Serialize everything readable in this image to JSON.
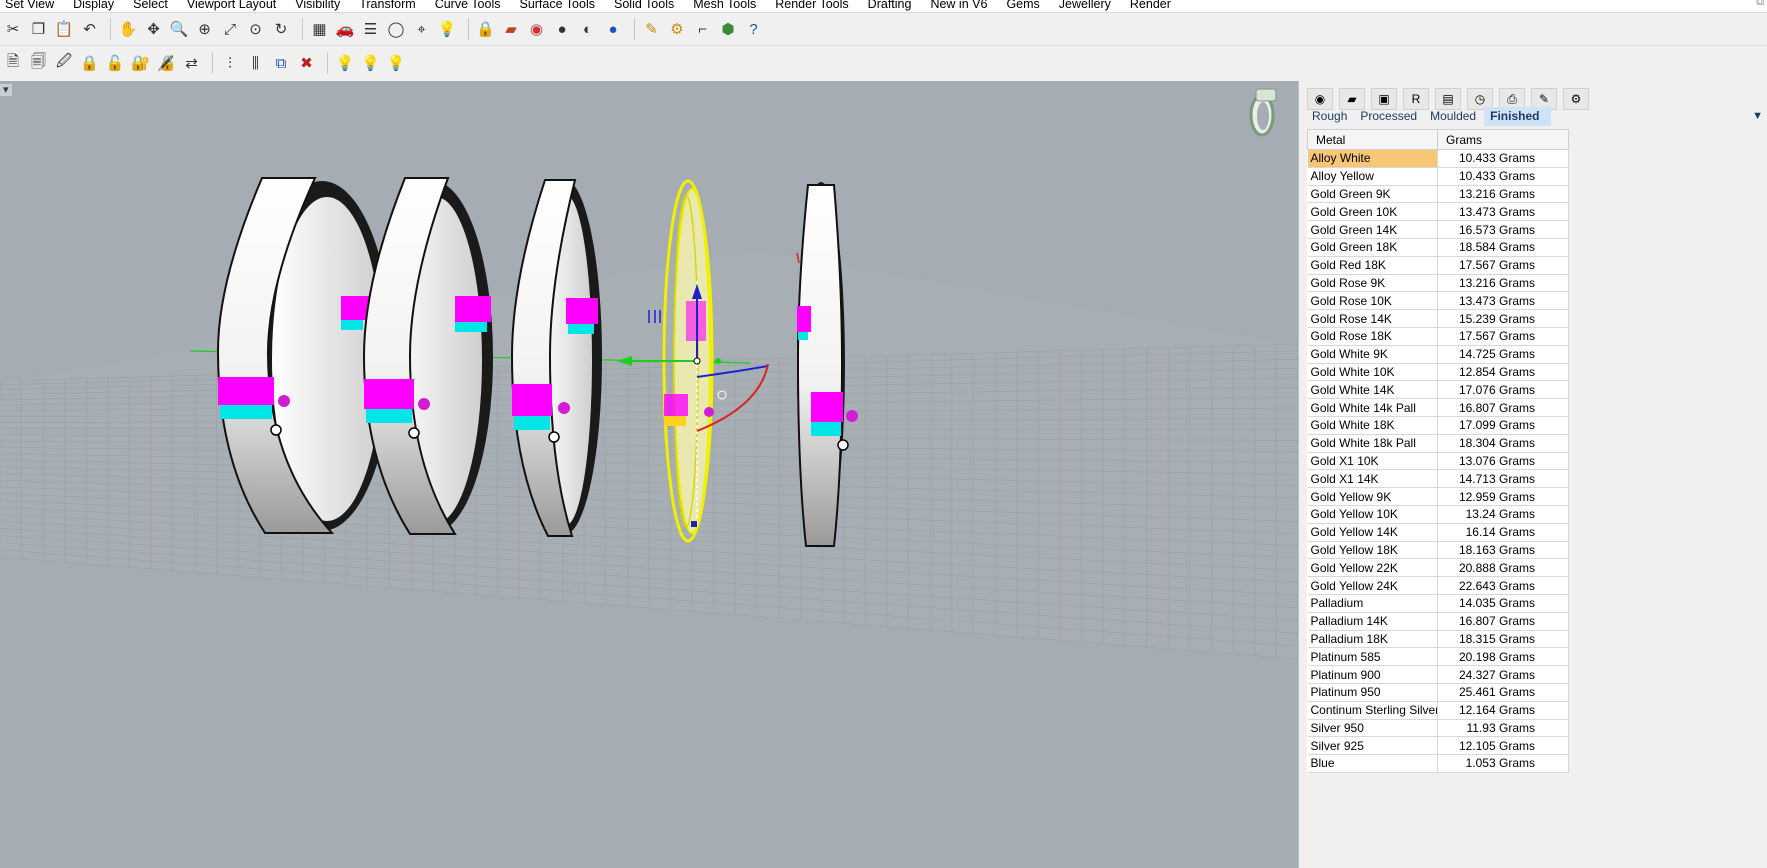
{
  "menu": [
    "Set View",
    "Display",
    "Select",
    "Viewport Layout",
    "Visibility",
    "Transform",
    "Curve Tools",
    "Surface Tools",
    "Solid Tools",
    "Mesh Tools",
    "Render Tools",
    "Drafting",
    "New in V6",
    "Gems",
    "Jewellery",
    "Render"
  ],
  "toolbar1_icons": [
    "cut-icon",
    "copy-icon",
    "paste-icon",
    "undo-icon",
    "pan-hand-icon",
    "rotate-icon",
    "zoom-icon",
    "zoom-window-icon",
    "zoom-extents-icon",
    "zoom-selected-icon",
    "rotate-view-icon",
    "grid-layout-icon",
    "car-icon",
    "layers-icon",
    "circle-icon",
    "snap-icon",
    "light-bulb-icon",
    "lock-icon",
    "material-icon",
    "color-wheel-icon",
    "shaded-sphere-icon",
    "rendered-sphere-icon",
    "blue-sphere-icon",
    "pen-icon",
    "gear-icon",
    "dimension-icon",
    "plugin-icon",
    "help-icon"
  ],
  "toolbar2_icons": [
    "document-icon",
    "document-properties-icon",
    "document-edit-icon",
    "lock-icon",
    "unlock-icon",
    "lock-selected-icon",
    "unlock-selected-icon",
    "swap-icon",
    "align-icon",
    "distribute-icon",
    "select-filter-icon",
    "delete-filter-icon",
    "bulb-on-icon",
    "bulb-off-icon",
    "bulb-toggle-icon"
  ],
  "panel": {
    "icons": [
      "color-icon",
      "material-icon",
      "display-icon",
      "rg-icon",
      "folder-icon",
      "time-icon",
      "print-icon",
      "edit-icon",
      "settings-icon"
    ],
    "tabs": [
      "Rough",
      "Processed",
      "Moulded",
      "Finished"
    ],
    "active_tab": "Finished",
    "columns": [
      "Metal",
      "Grams"
    ],
    "rows": [
      {
        "metal": "Alloy White",
        "grams": "10.433 Grams"
      },
      {
        "metal": "Alloy Yellow",
        "grams": "10.433 Grams"
      },
      {
        "metal": "Gold Green 9K",
        "grams": "13.216 Grams"
      },
      {
        "metal": "Gold Green 10K",
        "grams": "13.473 Grams"
      },
      {
        "metal": "Gold Green 14K",
        "grams": "16.573 Grams"
      },
      {
        "metal": "Gold Green 18K",
        "grams": "18.584 Grams"
      },
      {
        "metal": "Gold Red 18K",
        "grams": "17.567 Grams"
      },
      {
        "metal": "Gold Rose 9K",
        "grams": "13.216 Grams"
      },
      {
        "metal": "Gold Rose 10K",
        "grams": "13.473 Grams"
      },
      {
        "metal": "Gold Rose 14K",
        "grams": "15.239 Grams"
      },
      {
        "metal": "Gold Rose 18K",
        "grams": "17.567 Grams"
      },
      {
        "metal": "Gold White 9K",
        "grams": "14.725 Grams"
      },
      {
        "metal": "Gold White 10K",
        "grams": "12.854 Grams"
      },
      {
        "metal": "Gold White 14K",
        "grams": "17.076 Grams"
      },
      {
        "metal": "Gold White 14k Pall",
        "grams": "16.807 Grams"
      },
      {
        "metal": "Gold White 18K",
        "grams": "17.099 Grams"
      },
      {
        "metal": "Gold White 18k Pall",
        "grams": "18.304 Grams"
      },
      {
        "metal": "Gold X1 10K",
        "grams": "13.076 Grams"
      },
      {
        "metal": "Gold X1 14K",
        "grams": "14.713 Grams"
      },
      {
        "metal": "Gold Yellow 9K",
        "grams": "12.959 Grams"
      },
      {
        "metal": "Gold Yellow 10K",
        "grams": "13.24 Grams"
      },
      {
        "metal": "Gold Yellow 14K",
        "grams": "16.14 Grams"
      },
      {
        "metal": "Gold Yellow 18K",
        "grams": "18.163 Grams"
      },
      {
        "metal": "Gold Yellow 22K",
        "grams": "20.888 Grams"
      },
      {
        "metal": "Gold Yellow 24K",
        "grams": "22.643 Grams"
      },
      {
        "metal": "Palladium",
        "grams": "14.035 Grams"
      },
      {
        "metal": "Palladium 14K",
        "grams": "16.807 Grams"
      },
      {
        "metal": "Palladium 18K",
        "grams": "18.315 Grams"
      },
      {
        "metal": "Platinum 585",
        "grams": "20.198 Grams"
      },
      {
        "metal": "Platinum 900",
        "grams": "24.327 Grams"
      },
      {
        "metal": "Platinum 950",
        "grams": "25.461 Grams"
      },
      {
        "metal": "Continum Sterling Silver",
        "grams": "12.164 Grams"
      },
      {
        "metal": "Silver 950",
        "grams": "11.93 Grams"
      },
      {
        "metal": "Silver 925",
        "grams": "12.105 Grams"
      },
      {
        "metal": "Blue",
        "grams": "1.053 Grams"
      }
    ],
    "selected_row": 0
  },
  "colors": {
    "viewport_bg": "#a5acb3",
    "selection_yellow": "#f0f000",
    "magenta": "#ff00ff",
    "cyan": "#00e5e5",
    "selected_row": "#f7c776",
    "active_tab": "#cfe3f7"
  }
}
